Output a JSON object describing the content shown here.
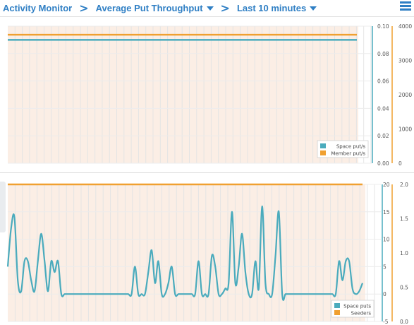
{
  "breadcrumb": {
    "root": "Activity Monitor",
    "separator": ">",
    "metric": "Average Put Throughput",
    "range": "Last 10 minutes"
  },
  "colors": {
    "accent": "#2f7fc4",
    "teal": "#4aabbd",
    "orange": "#f0a030",
    "plot_fill": "#fbeee5"
  },
  "icons": {
    "menu": "hamburger-menu-icon",
    "dropdown": "chevron-down-icon"
  },
  "chart_data": [
    {
      "type": "line",
      "series": [
        {
          "name": "Space put/s",
          "axis": "left",
          "color": "#4aabbd",
          "values": [
            0.09
          ]
        },
        {
          "name": "Member put/s",
          "axis": "right",
          "color": "#f0a030",
          "values": [
            3750
          ]
        }
      ],
      "left_axis": {
        "ticks": [
          "0.10",
          "0.08",
          "0.06",
          "0.04",
          "0.02",
          "0.00"
        ],
        "ylim": [
          0,
          0.1
        ]
      },
      "right_axis": {
        "ticks": [
          "4000",
          "3000",
          "2000",
          "1000",
          "0"
        ],
        "ylim": [
          0,
          4000
        ]
      },
      "grid": true,
      "legend": "bottom-right"
    },
    {
      "type": "line",
      "series": [
        {
          "name": "Space puts",
          "axis": "left",
          "color": "#4aabbd",
          "values": [
            5,
            12,
            14,
            2.5,
            0.5,
            6,
            6,
            2.5,
            0.5,
            6,
            11,
            6,
            0.5,
            6,
            4,
            6,
            0,
            0,
            0,
            0,
            0,
            0,
            0,
            0,
            0,
            0,
            0,
            0,
            0,
            0,
            0,
            0,
            0,
            0,
            0,
            0,
            0,
            0,
            5,
            0,
            0,
            0,
            4,
            8,
            2,
            6,
            0,
            0,
            2,
            5,
            0,
            0,
            0,
            0,
            0,
            0,
            0,
            6,
            0,
            0,
            0,
            7,
            5,
            0,
            0,
            1,
            2,
            15,
            2,
            5,
            11,
            4,
            0,
            0,
            6,
            1,
            16,
            2,
            0,
            0,
            7,
            15,
            0,
            0,
            0,
            0,
            0,
            0,
            0,
            0,
            0,
            0,
            0,
            0,
            0,
            0,
            0,
            0,
            0,
            6,
            2.5,
            6,
            6,
            1,
            0,
            0.5,
            2
          ]
        },
        {
          "name": "Seeders",
          "axis": "right",
          "color": "#f0a030",
          "values": [
            2
          ]
        }
      ],
      "left_axis": {
        "ticks": [
          "20",
          "15",
          "10",
          "5",
          "0",
          "-5"
        ],
        "ylim": [
          -5,
          20
        ]
      },
      "right_axis": {
        "ticks": [
          "2.0",
          "1.5",
          "1.0",
          "0.5",
          "0.0"
        ],
        "ylim": [
          0,
          2
        ]
      },
      "grid": true,
      "legend": "bottom-right"
    }
  ]
}
